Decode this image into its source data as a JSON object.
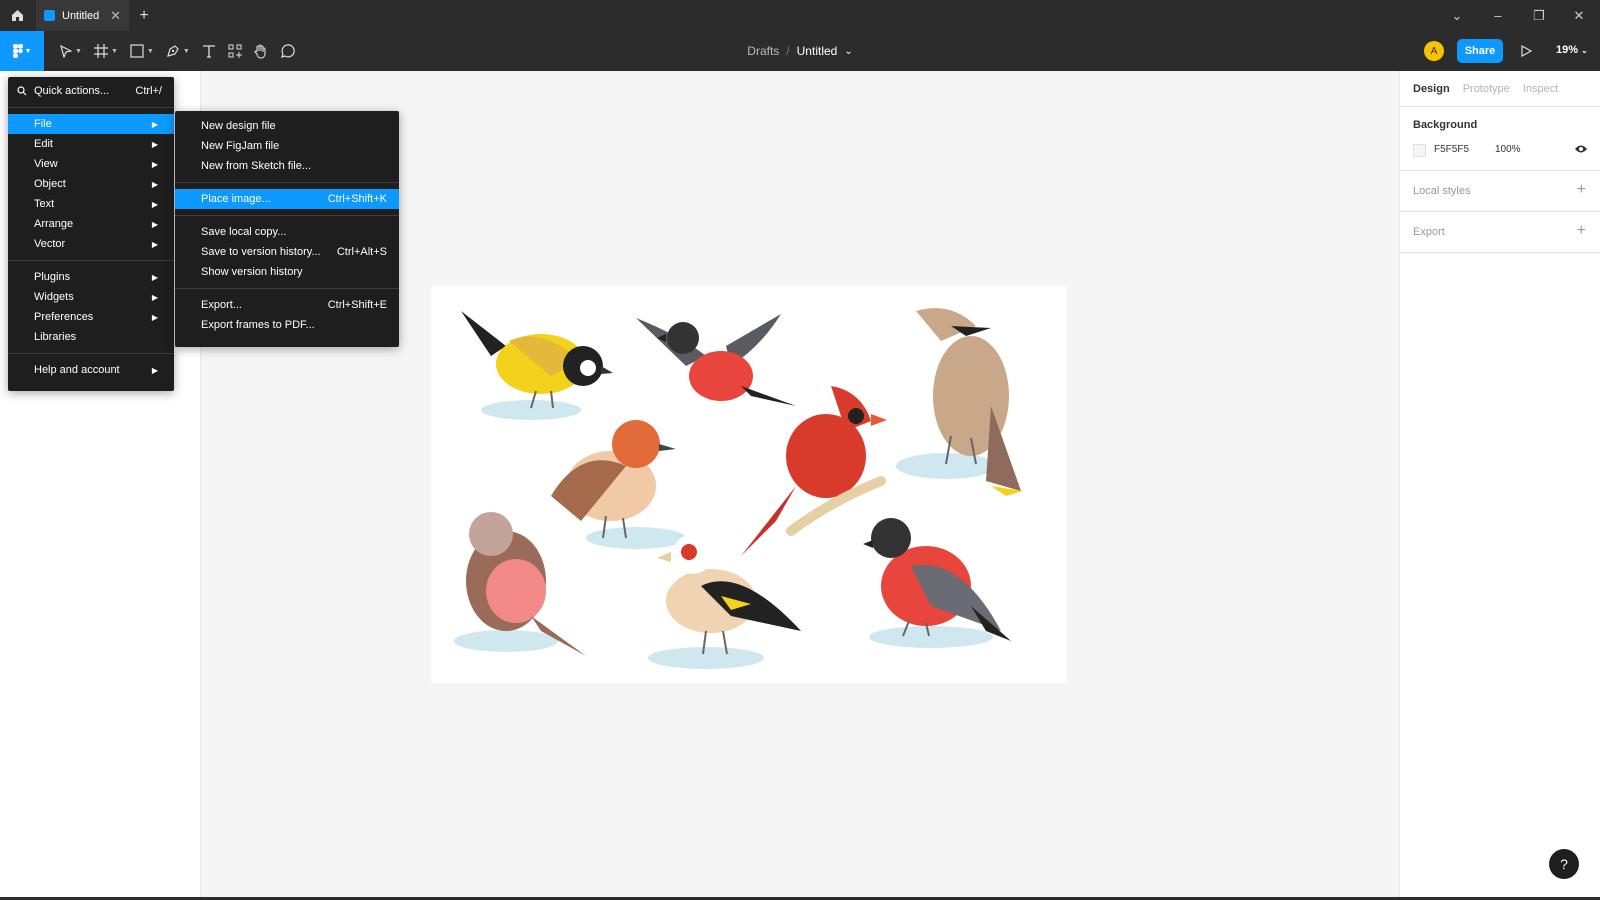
{
  "titlebar": {
    "tab_title": "Untitled",
    "tab_close": "✕",
    "new_tab": "+"
  },
  "window": {
    "dropdown": "⌄",
    "minimize": "–",
    "restore": "❐",
    "close": "✕"
  },
  "toolbar": {
    "breadcrumb_parent": "Drafts",
    "breadcrumb_sep": "/",
    "file_name": "Untitled",
    "file_chevron": "⌄",
    "avatar_initial": "A",
    "share_label": "Share",
    "zoom_label": "19%"
  },
  "main_menu": {
    "quick_actions_label": "Quick actions...",
    "quick_actions_shortcut": "Ctrl+/",
    "items": [
      {
        "label": "File"
      },
      {
        "label": "Edit"
      },
      {
        "label": "View"
      },
      {
        "label": "Object"
      },
      {
        "label": "Text"
      },
      {
        "label": "Arrange"
      },
      {
        "label": "Vector"
      },
      {
        "label": "Plugins"
      },
      {
        "label": "Widgets"
      },
      {
        "label": "Preferences"
      },
      {
        "label": "Libraries"
      },
      {
        "label": "Help and account"
      }
    ],
    "arrow": "▶"
  },
  "file_submenu": {
    "items": [
      {
        "label": "New design file",
        "shortcut": ""
      },
      {
        "label": "New FigJam file",
        "shortcut": ""
      },
      {
        "label": "New from Sketch file...",
        "shortcut": ""
      },
      {
        "label": "Place image...",
        "shortcut": "Ctrl+Shift+K"
      },
      {
        "label": "Save local copy...",
        "shortcut": ""
      },
      {
        "label": "Save to version history...",
        "shortcut": "Ctrl+Alt+S"
      },
      {
        "label": "Show version history",
        "shortcut": ""
      },
      {
        "label": "Export...",
        "shortcut": "Ctrl+Shift+E"
      },
      {
        "label": "Export frames to PDF...",
        "shortcut": ""
      }
    ]
  },
  "right_panel": {
    "tabs": [
      "Design",
      "Prototype",
      "Inspect"
    ],
    "background_title": "Background",
    "background_hex": "F5F5F5",
    "background_opacity": "100%",
    "local_styles": "Local styles",
    "export": "Export",
    "plus": "+"
  },
  "help_label": "?",
  "colors": {
    "accent": "#0d99ff",
    "canvas": "#f5f5f5",
    "menu_bg": "#1e1e1e"
  },
  "icons": [
    "home-icon",
    "figma-file-icon",
    "figma-logo-icon",
    "move-tool-icon",
    "frame-tool-icon",
    "shape-tool-icon",
    "pen-tool-icon",
    "text-tool-icon",
    "resources-icon",
    "hand-tool-icon",
    "comment-icon",
    "play-icon",
    "eye-icon",
    "search-icon",
    "help-icon"
  ]
}
